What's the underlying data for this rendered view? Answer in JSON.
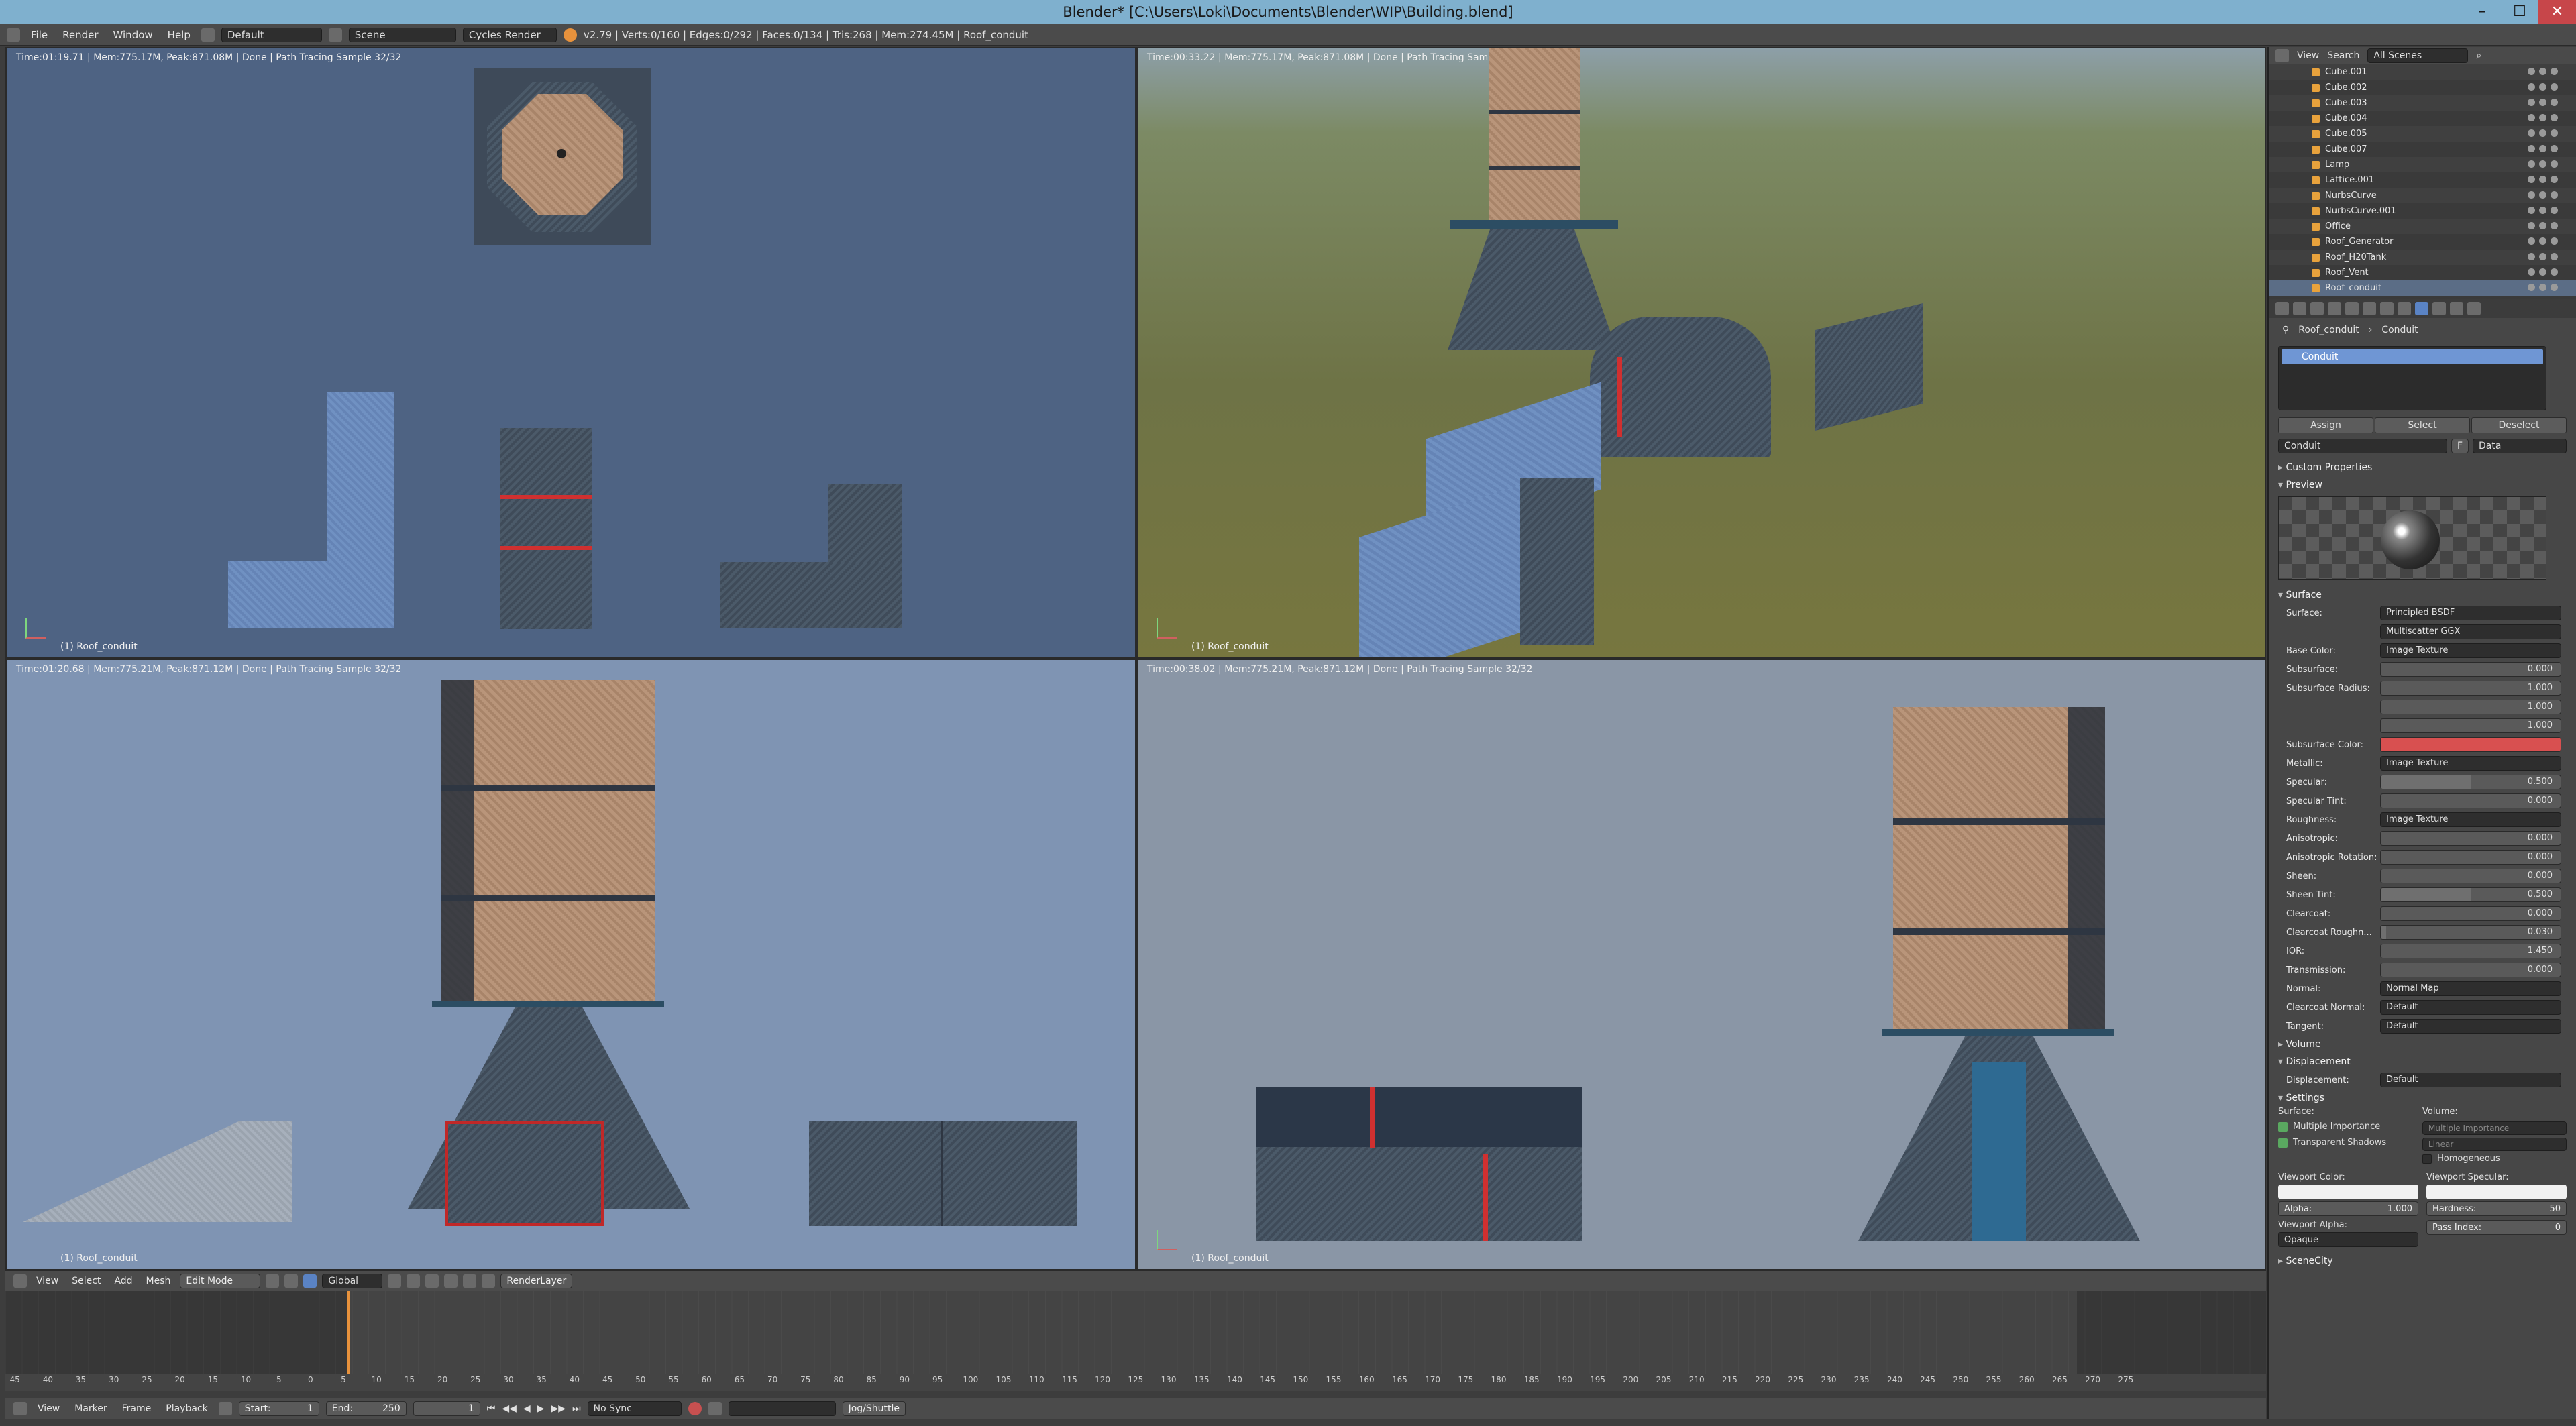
{
  "window": {
    "title": "Blender* [C:\\Users\\Loki\\Documents\\Blender\\WIP\\Building.blend]"
  },
  "info": {
    "menus": [
      "File",
      "Render",
      "Window",
      "Help"
    ],
    "layout": "Default",
    "scene": "Scene",
    "engine": "Cycles Render",
    "stats": "v2.79 | Verts:0/160 | Edges:0/292 | Faces:0/134 | Tris:268 | Mem:274.45M | Roof_conduit"
  },
  "viewports": {
    "top_left": {
      "header": "Time:01:19.71 | Mem:775.17M, Peak:871.08M | Done | Path Tracing Sample 32/32",
      "label": "(1) Roof_conduit"
    },
    "top_right": {
      "header": "Time:00:33.22 | Mem:775.17M, Peak:871.08M | Done | Path Tracing Sample 32/32",
      "label": "(1) Roof_conduit"
    },
    "bottom_left": {
      "header": "Time:01:20.68 | Mem:775.21M, Peak:871.12M | Done | Path Tracing Sample 32/32",
      "label": "(1) Roof_conduit"
    },
    "bottom_right": {
      "header": "Time:00:38.02 | Mem:775.21M, Peak:871.12M | Done | Path Tracing Sample 32/32",
      "label": "(1) Roof_conduit"
    }
  },
  "outliner": {
    "header": {
      "view": "View",
      "search": "Search",
      "filter": "All Scenes"
    },
    "items": [
      "Cube.001",
      "Cube.002",
      "Cube.003",
      "Cube.004",
      "Cube.005",
      "Cube.007",
      "Lamp",
      "Lattice.001",
      "NurbsCurve",
      "NurbsCurve.001",
      "Office",
      "Roof_Generator",
      "Roof_H20Tank",
      "Roof_Vent",
      "Roof_conduit"
    ]
  },
  "properties": {
    "breadcrumb": {
      "object": "Roof_conduit",
      "material": "Conduit"
    },
    "slot": "Conduit",
    "assign": "Assign",
    "select": "Select",
    "deselect": "Deselect",
    "material_name": "Conduit",
    "material_user": "F",
    "link": "Data",
    "sections": {
      "custom": "Custom Properties",
      "preview": "Preview",
      "surface": "Surface",
      "volume": "Volume",
      "displacement": "Displacement",
      "settings": "Settings",
      "scenecity": "SceneCity"
    },
    "surface_rows": [
      {
        "label": "Surface:",
        "kind": "dd",
        "value": "Principled BSDF"
      },
      {
        "label": "",
        "kind": "dd",
        "value": "Multiscatter GGX"
      },
      {
        "label": "Base Color:",
        "kind": "dd",
        "value": "Image Texture"
      },
      {
        "label": "Subsurface:",
        "kind": "num",
        "value": "0.000",
        "fill": 0
      },
      {
        "label": "Subsurface Radius:",
        "kind": "num",
        "value": "1.000",
        "fill": 0
      },
      {
        "label": "",
        "kind": "num",
        "value": "1.000",
        "fill": 0
      },
      {
        "label": "",
        "kind": "num",
        "value": "1.000",
        "fill": 0
      },
      {
        "label": "Subsurface Color:",
        "kind": "color",
        "value": "#d85050"
      },
      {
        "label": "Metallic:",
        "kind": "dd",
        "value": "Image Texture"
      },
      {
        "label": "Specular:",
        "kind": "num",
        "value": "0.500",
        "fill": 0.5
      },
      {
        "label": "Specular Tint:",
        "kind": "num",
        "value": "0.000",
        "fill": 0
      },
      {
        "label": "Roughness:",
        "kind": "dd",
        "value": "Image Texture"
      },
      {
        "label": "Anisotropic:",
        "kind": "num",
        "value": "0.000",
        "fill": 0
      },
      {
        "label": "Anisotropic Rotation:",
        "kind": "num",
        "value": "0.000",
        "fill": 0
      },
      {
        "label": "Sheen:",
        "kind": "num",
        "value": "0.000",
        "fill": 0
      },
      {
        "label": "Sheen Tint:",
        "kind": "num",
        "value": "0.500",
        "fill": 0.5
      },
      {
        "label": "Clearcoat:",
        "kind": "num",
        "value": "0.000",
        "fill": 0
      },
      {
        "label": "Clearcoat Roughn...",
        "kind": "num",
        "value": "0.030",
        "fill": 0.03
      },
      {
        "label": "IOR:",
        "kind": "num",
        "value": "1.450",
        "fill": 0
      },
      {
        "label": "Transmission:",
        "kind": "num",
        "value": "0.000",
        "fill": 0
      },
      {
        "label": "Normal:",
        "kind": "dd",
        "value": "Normal Map"
      },
      {
        "label": "Clearcoat Normal:",
        "kind": "dd",
        "value": "Default"
      },
      {
        "label": "Tangent:",
        "kind": "dd",
        "value": "Default"
      }
    ],
    "displacement_label": "Displacement:",
    "displacement_value": "Default",
    "settings": {
      "surface_label": "Surface:",
      "volume_label": "Volume:",
      "multiple_importance": "Multiple Importance",
      "transparent_shadows": "Transparent Shadows",
      "vol_mi": "Multiple Importance",
      "vol_linear": "Linear",
      "homogeneous": "Homogeneous",
      "viewport_color": "Viewport Color:",
      "viewport_specular": "Viewport Specular:",
      "alpha": "Alpha:",
      "alpha_value": "1.000",
      "hardness": "Hardness:",
      "hardness_value": "50",
      "viewport_alpha": "Viewport Alpha:",
      "pass_index": "Pass Index:",
      "pass_index_value": "0",
      "opaque": "Opaque"
    }
  },
  "view3d_header": {
    "view": "View",
    "select": "Select",
    "add": "Add",
    "mesh": "Mesh",
    "mode": "Edit Mode",
    "orientation": "Global",
    "render_layer": "RenderLayer"
  },
  "timeline": {
    "ticks": [
      "-45",
      "-40",
      "-35",
      "-30",
      "-25",
      "-20",
      "-15",
      "-10",
      "-5",
      "0",
      "5",
      "10",
      "15",
      "20",
      "25",
      "30",
      "35",
      "40",
      "45",
      "50",
      "55",
      "60",
      "65",
      "70",
      "75",
      "80",
      "85",
      "90",
      "95",
      "100",
      "105",
      "110",
      "115",
      "120",
      "125",
      "130",
      "135",
      "140",
      "145",
      "150",
      "155",
      "160",
      "165",
      "170",
      "175",
      "180",
      "185",
      "190",
      "195",
      "200",
      "205",
      "210",
      "215",
      "220",
      "225",
      "230",
      "235",
      "240",
      "245",
      "250",
      "255",
      "260",
      "265",
      "270",
      "275"
    ],
    "menus": [
      "View",
      "Marker",
      "Frame",
      "Playback"
    ],
    "start_label": "Start:",
    "start": "1",
    "end_label": "End:",
    "end": "250",
    "current": "1",
    "sync": "No Sync",
    "jog": "Jog/Shuttle"
  }
}
